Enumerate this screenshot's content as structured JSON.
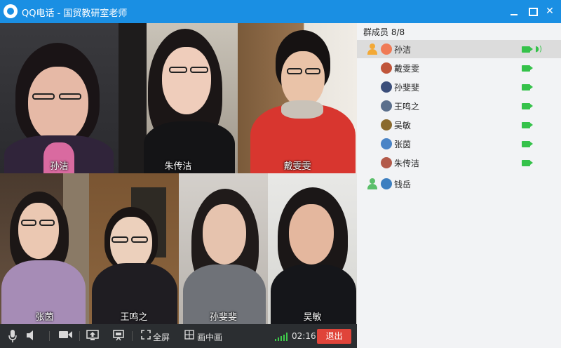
{
  "window": {
    "title": "QQ电话 - 国贸教研室老师",
    "close_glyph": "✕"
  },
  "video": {
    "tiles": [
      {
        "name": "孙洁"
      },
      {
        "name": "朱传洁"
      },
      {
        "name": "戴雯雯"
      },
      {
        "name": "张茵"
      },
      {
        "name": "王鸣之"
      },
      {
        "name": "孙斐斐"
      },
      {
        "name": "吴敏"
      }
    ]
  },
  "toolbar": {
    "fullscreen_label": "全屏",
    "pip_label": "画中画",
    "timer": "02:16",
    "exit_label": "退出"
  },
  "members": {
    "header": "群成员 8/8",
    "list": [
      {
        "name": "孙洁",
        "camera": true,
        "speaking": true,
        "selected": true
      },
      {
        "name": "戴雯雯",
        "camera": true
      },
      {
        "name": "孙斐斐",
        "camera": true
      },
      {
        "name": "王鸣之",
        "camera": true
      },
      {
        "name": "吴敏",
        "camera": true
      },
      {
        "name": "张茵",
        "camera": true
      },
      {
        "name": "朱传洁",
        "camera": true
      },
      {
        "name": "钱岳",
        "camera": false
      }
    ]
  },
  "colors": {
    "titlebar": "#1a8fe3",
    "exit": "#e0443a",
    "camera_on": "#35c24a"
  }
}
